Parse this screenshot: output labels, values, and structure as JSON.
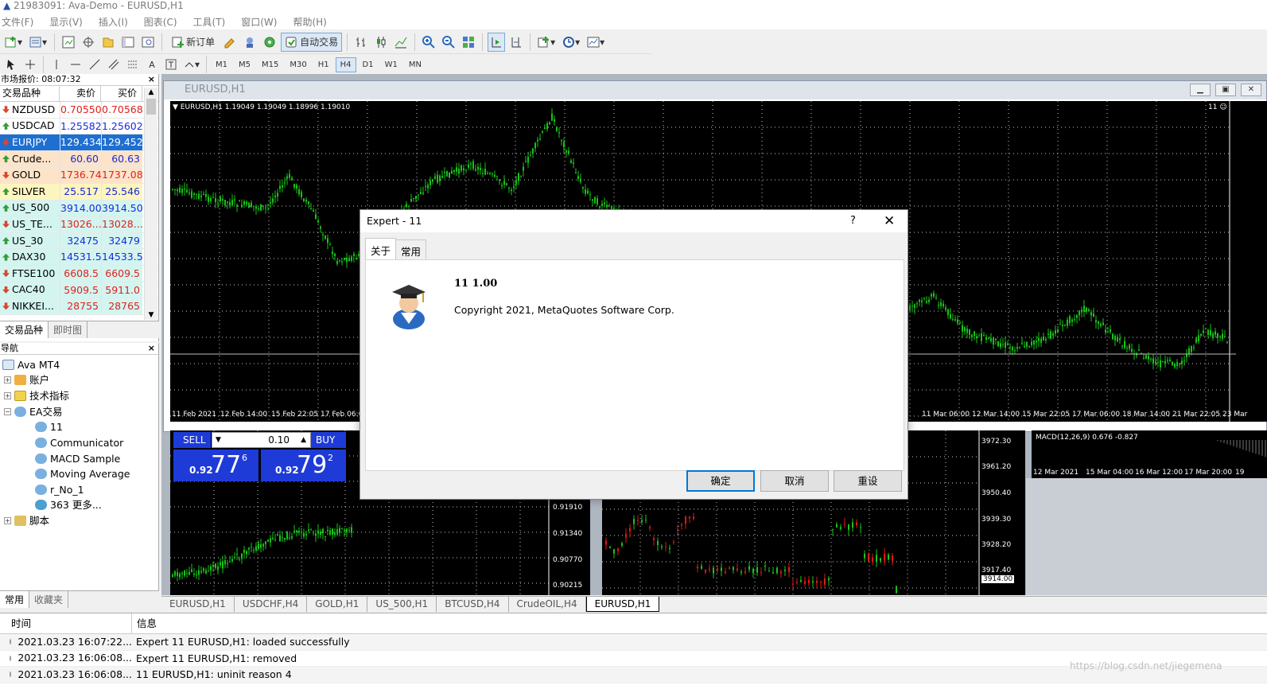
{
  "window": {
    "title": "21983091: Ava-Demo - EURUSD,H1"
  },
  "menu": [
    "文件(F)",
    "显示(V)",
    "插入(I)",
    "图表(C)",
    "工具(T)",
    "窗口(W)",
    "帮助(H)"
  ],
  "toolbar": {
    "new_order": "新订单",
    "auto_trading": "自动交易"
  },
  "timeframes": [
    "M1",
    "M5",
    "M15",
    "M30",
    "H1",
    "H4",
    "D1",
    "W1",
    "MN"
  ],
  "active_timeframe": "H4",
  "market_watch": {
    "title": "市场报价: 08:07:32",
    "close": "×",
    "col_symbol": "交易品种",
    "col_bid": "卖价",
    "col_ask": "买价",
    "rows": [
      {
        "symbol": "NZDUSD",
        "bid": "0.70550",
        "ask": "0.70568",
        "dir": "down"
      },
      {
        "symbol": "USDCAD",
        "bid": "1.25582",
        "ask": "1.25602",
        "dir": "up"
      },
      {
        "symbol": "EURJPY",
        "bid": "129.434",
        "ask": "129.452",
        "dir": "down"
      },
      {
        "symbol": "Crude...",
        "bid": "60.60",
        "ask": "60.63",
        "dir": "up"
      },
      {
        "symbol": "GOLD",
        "bid": "1736.74",
        "ask": "1737.08",
        "dir": "down"
      },
      {
        "symbol": "SILVER",
        "bid": "25.517",
        "ask": "25.546",
        "dir": "up"
      },
      {
        "symbol": "US_500",
        "bid": "3914.00",
        "ask": "3914.50",
        "dir": "up"
      },
      {
        "symbol": "US_TE...",
        "bid": "13026...",
        "ask": "13028...",
        "dir": "down"
      },
      {
        "symbol": "US_30",
        "bid": "32475",
        "ask": "32479",
        "dir": "up"
      },
      {
        "symbol": "DAX30",
        "bid": "14531.5",
        "ask": "14533.5",
        "dir": "up"
      },
      {
        "symbol": "FTSE100",
        "bid": "6608.5",
        "ask": "6609.5",
        "dir": "down"
      },
      {
        "symbol": "CAC40",
        "bid": "5909.5",
        "ask": "5911.0",
        "dir": "down"
      },
      {
        "symbol": "NIKKEI...",
        "bid": "28755",
        "ask": "28765",
        "dir": "down"
      }
    ],
    "tabs": [
      "交易品种",
      "即时图"
    ]
  },
  "navigator": {
    "title": "导航",
    "close": "×",
    "items": {
      "root": "Ava MT4",
      "accounts": "账户",
      "indicators": "技术指标",
      "ea": "EA交易",
      "ea1": "11",
      "ea2": "Communicator",
      "ea3": "MACD Sample",
      "ea4": "Moving Average",
      "ea5": "r_No_1",
      "ea6": "363 更多...",
      "scripts": "脚本"
    },
    "tabs": [
      "常用",
      "收藏夹"
    ]
  },
  "chart_window": {
    "title": "EURUSD,H1",
    "info": "EURUSD,H1  1.19049 1.19049 1.18996 1.19010",
    "ea_badge": "11",
    "time_labels": [
      "11 Feb 2021",
      "12 Feb 14:00",
      "15 Feb 22:05",
      "17 Feb 06:00",
      "11 Mar 06:00",
      "12 Mar 14:00",
      "15 Mar 22:05",
      "17 Mar 06:00",
      "18 Mar 14:00",
      "21 Mar 22:05",
      "23 Mar"
    ]
  },
  "one_click": {
    "sell_label": "SELL",
    "buy_label": "BUY",
    "lot": "0.10",
    "sell_prefix": "0.92",
    "sell_big": "77",
    "sell_sup": "6",
    "buy_prefix": "0.92",
    "buy_big": "79",
    "buy_sup": "2"
  },
  "chart2_prices": [
    "0.91910",
    "0.91340",
    "0.90770",
    "0.90215"
  ],
  "chart3_prices": [
    "3972.30",
    "3961.20",
    "3950.40",
    "3939.30",
    "3928.20",
    "3917.40",
    "3914.00"
  ],
  "chart4": {
    "indicator": "MACD(12,26,9) 0.676 -0.827",
    "time_labels": [
      "12 Mar 2021",
      "15 Mar 04:00",
      "16 Mar 12:00",
      "17 Mar 20:00",
      "19"
    ]
  },
  "chart_tabs": [
    "EURUSD,H1",
    "USDCHF,H4",
    "GOLD,H1",
    "US_500,H1",
    "BTCUSD,H4",
    "CrudeOIL,H4",
    "EURUSD,H1"
  ],
  "active_chart_tab": 6,
  "terminal": {
    "col_time": "时间",
    "col_info": "信息",
    "rows": [
      {
        "time": "2021.03.23 16:07:22...",
        "msg": "Expert 11 EURUSD,H1: loaded successfully"
      },
      {
        "time": "2021.03.23 16:06:08...",
        "msg": "Expert 11 EURUSD,H1: removed"
      },
      {
        "time": "2021.03.23 16:06:08...",
        "msg": "11 EURUSD,H1: uninit reason 4"
      }
    ]
  },
  "watermark": "https://blog.csdn.net/jiegemena",
  "dialog": {
    "title": "Expert - 11",
    "help": "?",
    "close": "✕",
    "tabs": [
      "关于",
      "常用"
    ],
    "name_version": "11 1.00",
    "copyright": "Copyright 2021, MetaQuotes Software Corp.",
    "ok": "确定",
    "cancel": "取消",
    "reset": "重设"
  },
  "colors": {
    "buy_blue": "#1e3bd8",
    "candle_green": "#18c418",
    "candle_red": "#e01818",
    "dialog_accent": "#0078d7"
  }
}
